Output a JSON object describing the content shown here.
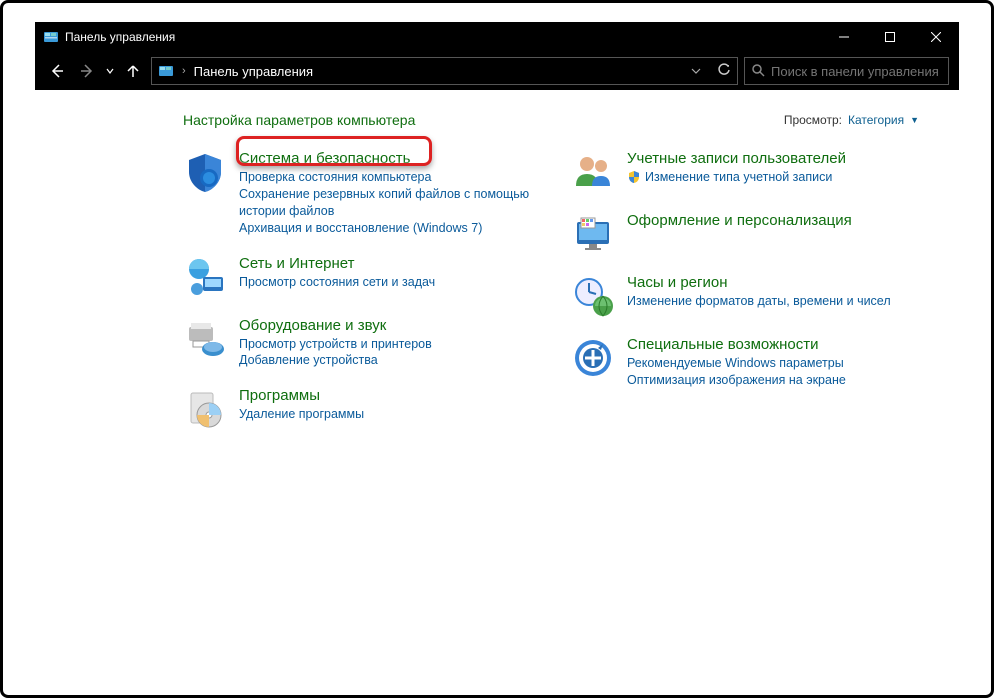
{
  "window": {
    "title": "Панель управления"
  },
  "nav": {
    "breadcrumb": "Панель управления",
    "search_placeholder": "Поиск в панели управления"
  },
  "main_heading": "Настройка параметров компьютера",
  "view": {
    "label": "Просмотр:",
    "value": "Категория"
  },
  "left_col": [
    {
      "title": "Система и безопасность",
      "links": [
        "Проверка состояния компьютера",
        "Сохранение резервных копий файлов с помощью истории файлов",
        "Архивация и восстановление (Windows 7)"
      ]
    },
    {
      "title": "Сеть и Интернет",
      "links": [
        "Просмотр состояния сети и задач"
      ]
    },
    {
      "title": "Оборудование и звук",
      "links": [
        "Просмотр устройств и принтеров",
        "Добавление устройства"
      ]
    },
    {
      "title": "Программы",
      "links": [
        "Удаление программы"
      ]
    }
  ],
  "right_col": [
    {
      "title": "Учетные записи пользователей",
      "links": [
        "Изменение типа учетной записи"
      ],
      "shield": [
        true
      ]
    },
    {
      "title": "Оформление и персонализация",
      "links": []
    },
    {
      "title": "Часы и регион",
      "links": [
        "Изменение форматов даты, времени и чисел"
      ]
    },
    {
      "title": "Специальные возможности",
      "links": [
        "Рекомендуемые Windows параметры",
        "Оптимизация изображения на экране"
      ]
    }
  ]
}
